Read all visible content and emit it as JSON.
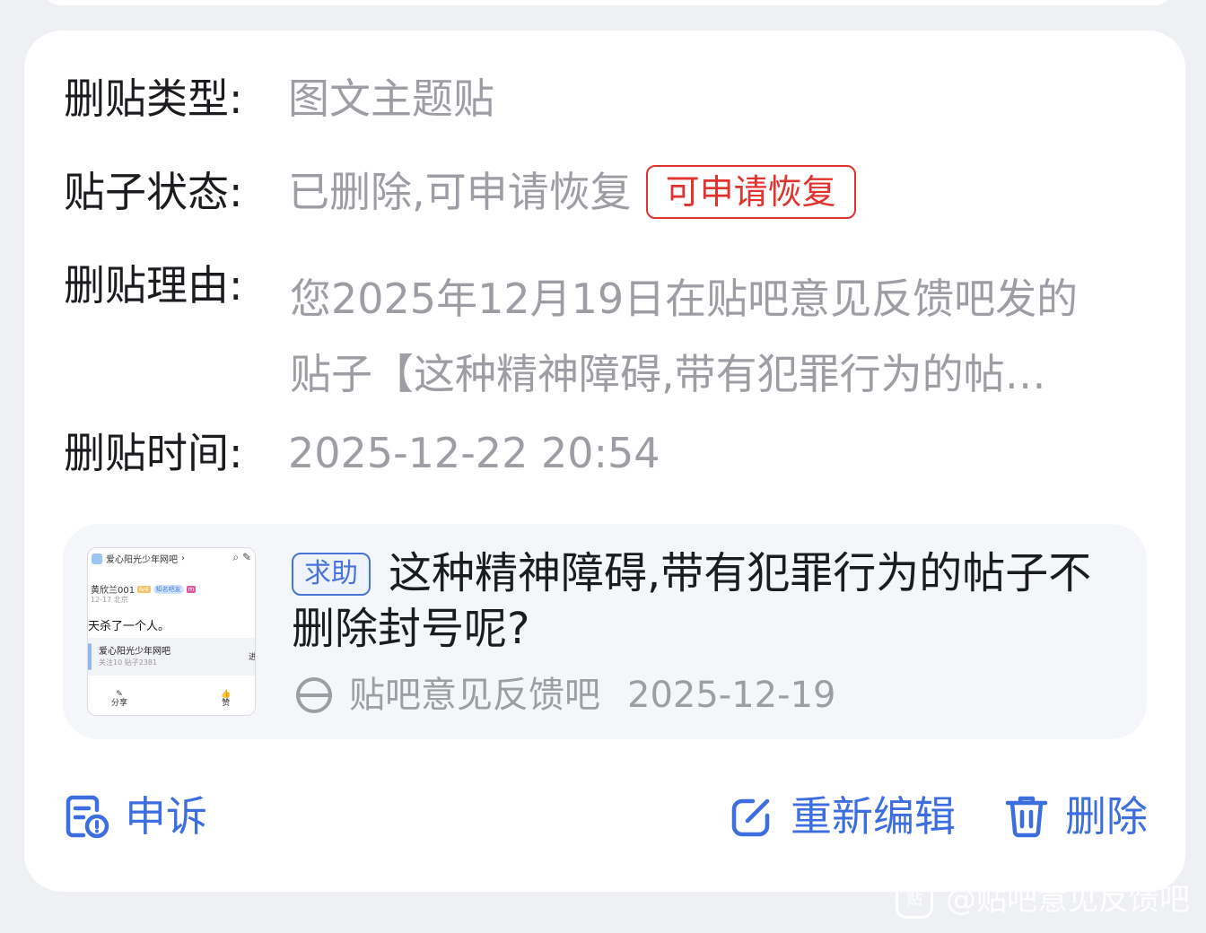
{
  "fields": {
    "type_label": "删贴类型:",
    "type_value": "图文主题贴",
    "status_label": "贴子状态:",
    "status_value": "已删除,可申请恢复",
    "status_tag": "可申请恢复",
    "reason_label": "删贴理由:",
    "reason_line1": "您2025年12月19日在贴吧意见反馈吧发的",
    "reason_line2": "贴子【这种精神障碍,带有犯罪行为的帖…",
    "time_label": "删贴时间:",
    "time_value": "2025-12-22 20:54"
  },
  "post": {
    "tag": "求助",
    "title": "这种精神障碍,带有犯罪行为的帖子不删除封号呢?",
    "forum": "贴吧意见反馈吧",
    "date": "2025-12-19",
    "thumbnail": {
      "forum_name": "爱心阳光少年网吧",
      "user": "黄欣兰001",
      "level": "lv4",
      "chip": "知名吧友",
      "badge": "m",
      "post_date": "12-17 北京",
      "text": "天杀了一个人。",
      "card_name": "爱心阳光少年网吧",
      "card_stats": "关注10  贴子2381",
      "card_go": "进",
      "share_label": "分享",
      "like_label": "赞"
    }
  },
  "actions": {
    "appeal": "申诉",
    "reedit": "重新编辑",
    "delete": "删除"
  },
  "watermark": {
    "logo": "贴",
    "text": "@贴吧意见反馈吧"
  },
  "colors": {
    "accent_blue": "#3d6ee0",
    "status_red": "#e0322e",
    "muted_text": "#9c9ea4"
  }
}
